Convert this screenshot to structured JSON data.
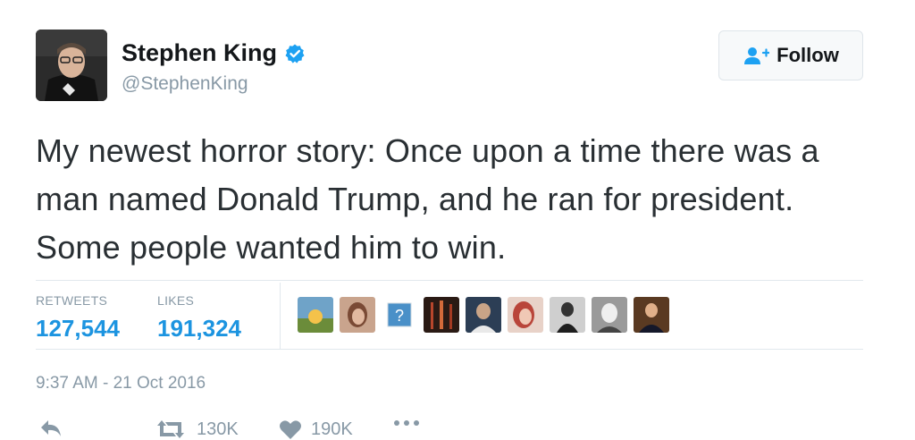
{
  "author": {
    "name": "Stephen King",
    "handle": "@StephenKing",
    "verified_icon": "verified-badge-icon"
  },
  "follow_button": {
    "label": "Follow",
    "icon": "add-user-icon"
  },
  "tweet": {
    "text": "My newest horror story: Once upon a time there was a man named Donald Trump, and he ran for president. Some people wanted him to win."
  },
  "stats": {
    "retweets_label": "RETWEETS",
    "retweets_value": "127,544",
    "likes_label": "LIKES",
    "likes_value": "191,324"
  },
  "timestamp": "9:37 AM - 21 Oct 2016",
  "actions": {
    "retweet_count": "130K",
    "like_count": "190K"
  },
  "colors": {
    "accent": "#1c94e0",
    "muted": "#8899a6",
    "text": "#292f33"
  }
}
